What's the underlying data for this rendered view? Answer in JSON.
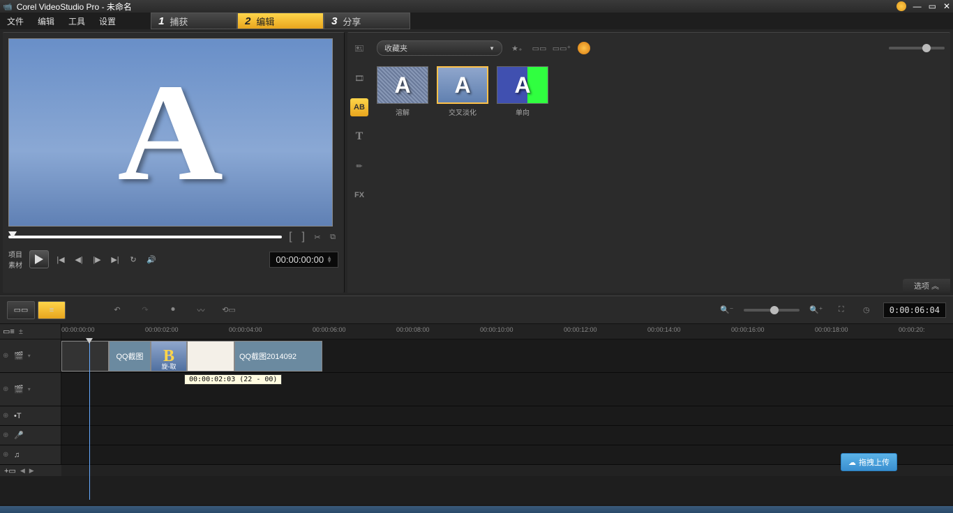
{
  "titlebar": {
    "app": "Corel VideoStudio Pro",
    "doc": "未命名"
  },
  "menu": {
    "file": "文件",
    "edit": "编辑",
    "tools": "工具",
    "settings": "设置"
  },
  "steps": {
    "s1": {
      "n": "1",
      "l": "捕获"
    },
    "s2": {
      "n": "2",
      "l": "编辑"
    },
    "s3": {
      "n": "3",
      "l": "分享"
    }
  },
  "preview": {
    "project": "项目",
    "clip": "素材",
    "timecode": "00:00:00:00"
  },
  "library": {
    "dropdown": "收藏夹",
    "items": [
      {
        "label": "溶解"
      },
      {
        "label": "交叉淡化"
      },
      {
        "label": "单向"
      }
    ],
    "options": "选项  ︽"
  },
  "timeline": {
    "timecode": "0:00:06:04",
    "ticks": [
      "00:00:00:00",
      "00:00:02:00",
      "00:00:04:00",
      "00:00:06:00",
      "00:00:08:00",
      "00:00:10:00",
      "00:00:12:00",
      "00:00:14:00",
      "00:00:16:00",
      "00:00:18:00",
      "00:00:20:"
    ],
    "clip1": "QQ截图",
    "clip_trans_sub": "旋-取",
    "clip2": "QQ截图2014092",
    "tooltip": "00:00:02:03 (22 - 00)"
  },
  "upload": "拖拽上传"
}
